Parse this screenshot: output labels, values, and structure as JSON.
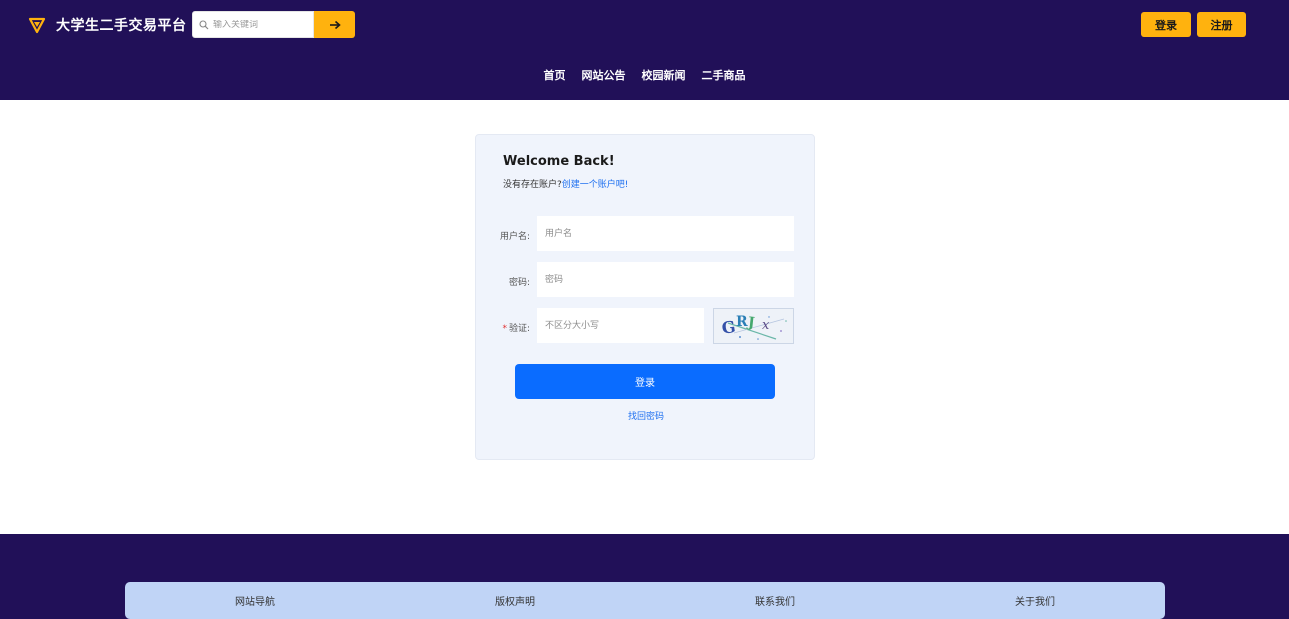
{
  "header": {
    "brand_title": "大学生二手交易平台",
    "brand_icon": "triangle-logo-icon",
    "search_placeholder": "输入关键词",
    "search_button_icon": "arrow-right-icon",
    "login_label": "登录",
    "register_label": "注册"
  },
  "nav": {
    "items": [
      {
        "label": "首页"
      },
      {
        "label": "网站公告"
      },
      {
        "label": "校园新闻"
      },
      {
        "label": "二手商品"
      }
    ]
  },
  "login_form": {
    "title": "Welcome Back!",
    "subtitle_prefix": "没有存在账户?",
    "subtitle_link": "创建一个账户吧!",
    "username_label": "用户名:",
    "username_placeholder": "用户名",
    "password_label": "密码:",
    "password_placeholder": "密码",
    "captcha_required_mark": "*",
    "captcha_label": "验证:",
    "captcha_placeholder": "不区分大小写",
    "captcha_text": "GRJx",
    "submit_label": "登录",
    "forgot_label": "找回密码"
  },
  "footer": {
    "links": [
      {
        "label": "网站导航"
      },
      {
        "label": "版权声明"
      },
      {
        "label": "联系我们"
      },
      {
        "label": "关于我们"
      }
    ]
  },
  "colors": {
    "header_bg": "#211058",
    "accent_yellow": "#ffb20e",
    "primary_blue": "#0a6cff",
    "card_bg": "#f0f4fc",
    "footer_bar_bg": "#c0d4f6"
  }
}
